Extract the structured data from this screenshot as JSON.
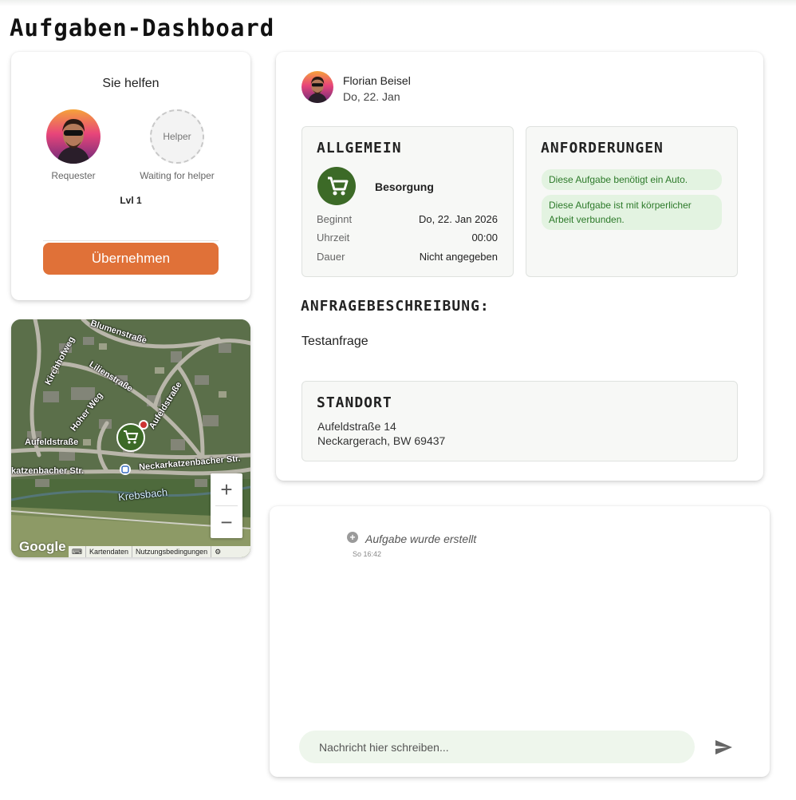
{
  "page": {
    "title": "Aufgaben-Dashboard"
  },
  "helper_card": {
    "heading": "Sie helfen",
    "requester_label": "Requester",
    "helper_placeholder": "Helper",
    "helper_label": "Waiting for helper",
    "level": "Lvl 1",
    "take_button": "Übernehmen"
  },
  "map": {
    "streets": {
      "blumen": "Blumenstraße",
      "kirchhof": "Kirchhofweg",
      "lilien": "Lilienstraße",
      "hoher": "Hoher Weg",
      "aufeld_v": "Aufeldstraße",
      "aufeld_h": "Aufeldstraße",
      "neckar_right": "Neckarkatzenbacher Str.",
      "neckar_left": "katzenbacher Str.",
      "krebsbach": "Krebsbach"
    },
    "zoom_in": "+",
    "zoom_out": "−",
    "logo": "Google",
    "footer": {
      "keyboard": "⌨",
      "map_data": "Kartendaten",
      "terms": "Nutzungsbedingungen",
      "report": "⚙"
    }
  },
  "task": {
    "author": "Florian Beisel",
    "date": "Do, 22. Jan",
    "general": {
      "heading": "ALLGEMEIN",
      "category": "Besorgung",
      "rows": [
        {
          "label": "Beginnt",
          "value": "Do, 22. Jan 2026"
        },
        {
          "label": "Uhrzeit",
          "value": "00:00"
        },
        {
          "label": "Dauer",
          "value": "Nicht angegeben"
        }
      ]
    },
    "requirements": {
      "heading": "ANFORDERUNGEN",
      "items": [
        "Diese Aufgabe benötigt ein Auto.",
        "Diese Aufgabe ist mit körperlicher Arbeit verbunden."
      ]
    },
    "description": {
      "heading": "ANFRAGEBESCHREIBUNG:",
      "text": "Testanfrage"
    },
    "location": {
      "heading": "STANDORT",
      "street": "Aufeldstraße 14",
      "city": "Neckargerach, BW 69437"
    }
  },
  "chat": {
    "event_text": "Aufgabe wurde erstellt",
    "event_time": "So 16:42",
    "input_placeholder": "Nachricht hier schreiben..."
  },
  "colors": {
    "accent_orange": "#e07138",
    "category_green": "#3c6a27",
    "tag_background": "#e3f3e1",
    "tag_text": "#2d7a2a"
  }
}
